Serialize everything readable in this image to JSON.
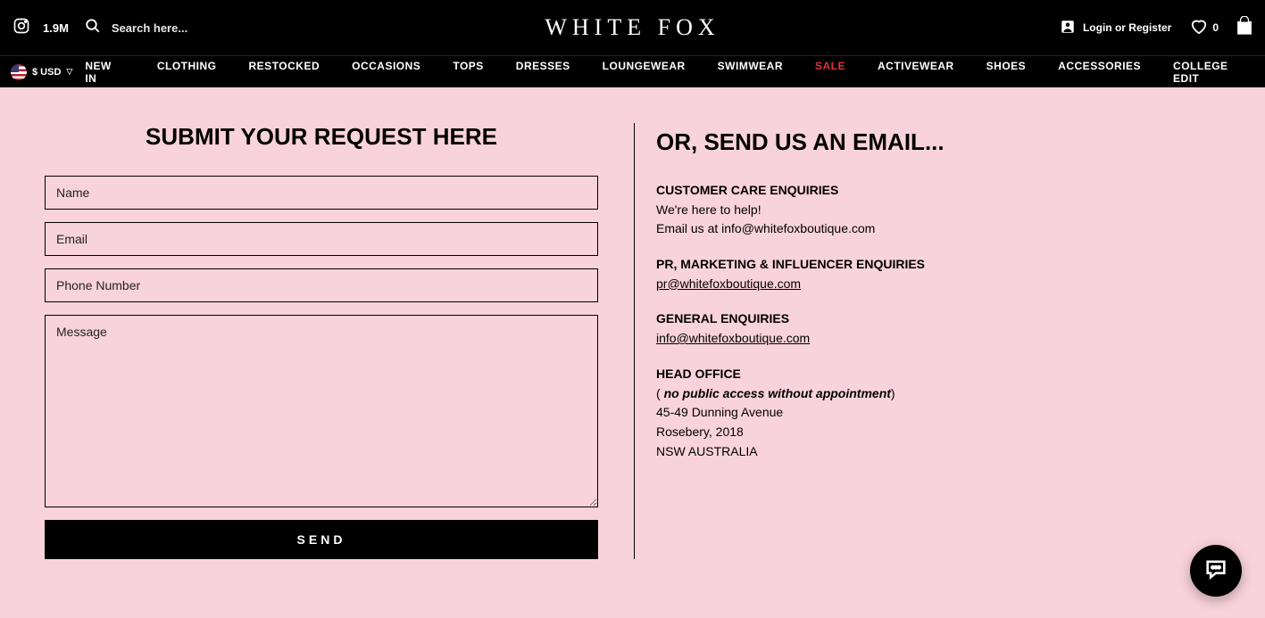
{
  "topbar": {
    "follow_count": "1.9M",
    "search_placeholder": "Search here...",
    "logo_text": "WHITE FOX",
    "login_text": "Login or Register",
    "wish_count": "0"
  },
  "currency": {
    "label": "$ USD"
  },
  "nav": [
    {
      "label": "NEW IN",
      "sale": false
    },
    {
      "label": "CLOTHING",
      "sale": false
    },
    {
      "label": "RESTOCKED",
      "sale": false
    },
    {
      "label": "OCCASIONS",
      "sale": false
    },
    {
      "label": "TOPS",
      "sale": false
    },
    {
      "label": "DRESSES",
      "sale": false
    },
    {
      "label": "LOUNGEWEAR",
      "sale": false
    },
    {
      "label": "SWIMWEAR",
      "sale": false
    },
    {
      "label": "SALE",
      "sale": true
    },
    {
      "label": "ACTIVEWEAR",
      "sale": false
    },
    {
      "label": "SHOES",
      "sale": false
    },
    {
      "label": "ACCESSORIES",
      "sale": false
    },
    {
      "label": "COLLEGE EDIT",
      "sale": false
    }
  ],
  "form": {
    "title": "SUBMIT YOUR REQUEST HERE",
    "name_ph": "Name",
    "email_ph": "Email",
    "phone_ph": "Phone Number",
    "message_ph": "Message",
    "send_label": "SEND"
  },
  "email_section": {
    "title": "OR, SEND US AN EMAIL...",
    "care_heading": "CUSTOMER CARE ENQUIRIES",
    "care_line1": "We're here to help!",
    "care_line2": "Email us at info@whitefoxboutique.com",
    "pr_heading": "PR, MARKETING & INFLUENCER ENQUIRIES",
    "pr_link": "pr@whitefoxboutique.com",
    "gen_heading": "GENERAL ENQUIRIES",
    "gen_link": "info@whitefoxboutique.com",
    "office_heading": "HEAD OFFICE",
    "office_note_open": "( ",
    "office_note_italic": "no public access without appointment",
    "office_note_close": ")",
    "office_addr1": "45-49 Dunning Avenue",
    "office_addr2": "Rosebery, 2018",
    "office_addr3": "NSW AUSTRALIA"
  }
}
